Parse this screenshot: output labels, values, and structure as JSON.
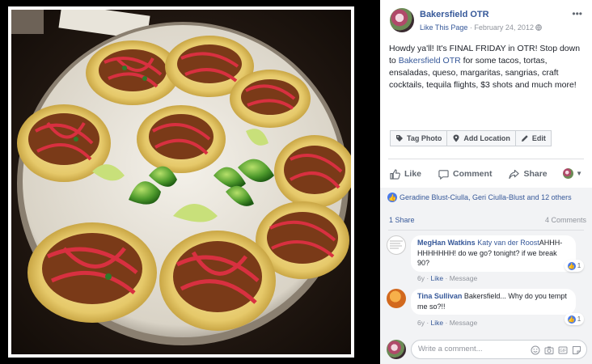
{
  "post": {
    "page_name": "Bakersfield OTR",
    "like_page": "Like This Page",
    "dot": "·",
    "date": "February 24, 2012",
    "text_before": "Howdy ya'll! It's FINAL FRIDAY in OTR! Stop down to ",
    "text_tag": "Bakersfield OTR",
    "text_after": " for some tacos, tortas, ensaladas, queso, margaritas, sangrias, craft cocktails, tequila flights, $3 shots and much more!"
  },
  "photo_actions": {
    "tag_photo": "Tag Photo",
    "add_location": "Add Location",
    "edit": "Edit"
  },
  "actions": {
    "like": "Like",
    "comment": "Comment",
    "share": "Share"
  },
  "reactions": {
    "summary": "Geradine Blust-Ciulla, Geri Ciulla-Blust and 12 others",
    "shares": "1 Share",
    "comments_count": "4 Comments"
  },
  "comments": [
    {
      "author": "MegHan Watkins",
      "mention": "Katy van der Roost",
      "text": "AHHH-HHHHHHH! do we go? tonight? if we break 90?",
      "time": "6y",
      "like": "Like",
      "message": "Message",
      "reactions": "1"
    },
    {
      "author": "Tina Sullivan",
      "text": "Bakersfield... Why do you tempt me so?!!",
      "time": "6y",
      "like": "Like",
      "message": "Message",
      "reactions": "1"
    }
  ],
  "composer": {
    "placeholder": "Write a comment..."
  },
  "colors": {
    "link": "#365899",
    "like_blue": "#4a7ae8",
    "gray_text": "#90949c"
  }
}
